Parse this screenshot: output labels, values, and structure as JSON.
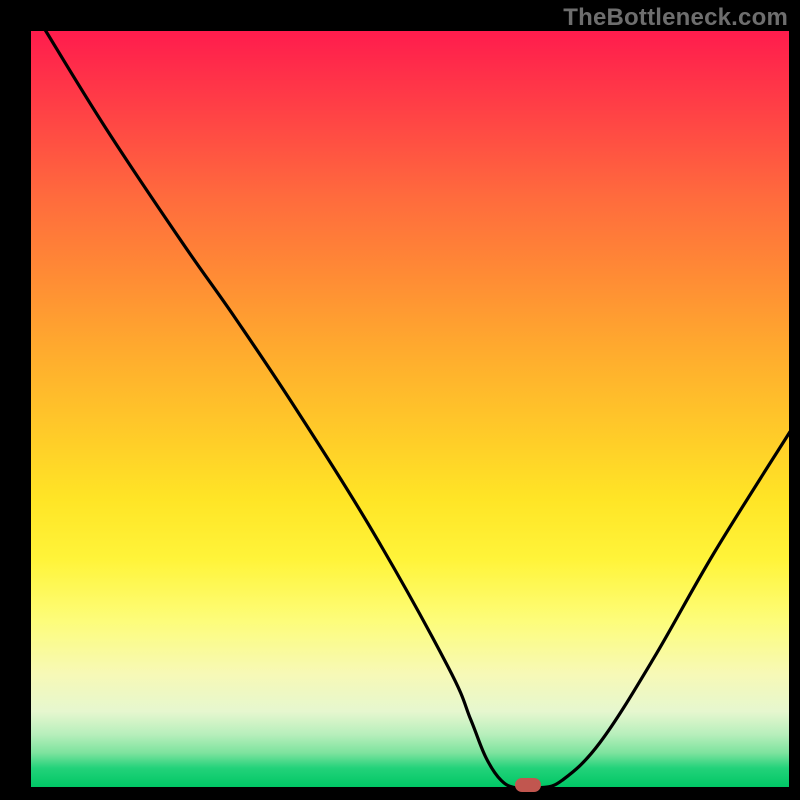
{
  "watermark": "TheBottleneck.com",
  "chart_data": {
    "type": "line",
    "title": "",
    "xlabel": "",
    "ylabel": "",
    "xlim": [
      0,
      100
    ],
    "ylim": [
      0,
      100
    ],
    "grid": false,
    "legend": false,
    "series": [
      {
        "name": "curve",
        "x": [
          2,
          10,
          20,
          27,
          35,
          45,
          55,
          58,
          60,
          62,
          64,
          67,
          70,
          75,
          82,
          90,
          100
        ],
        "y": [
          100,
          87,
          72,
          62,
          50,
          34,
          16,
          9,
          4,
          1,
          0,
          0,
          1,
          6,
          17,
          31,
          47
        ]
      }
    ],
    "marker": {
      "x": 65.5,
      "y": 0
    },
    "colors": {
      "line": "#000000",
      "marker": "#c1564f"
    }
  }
}
